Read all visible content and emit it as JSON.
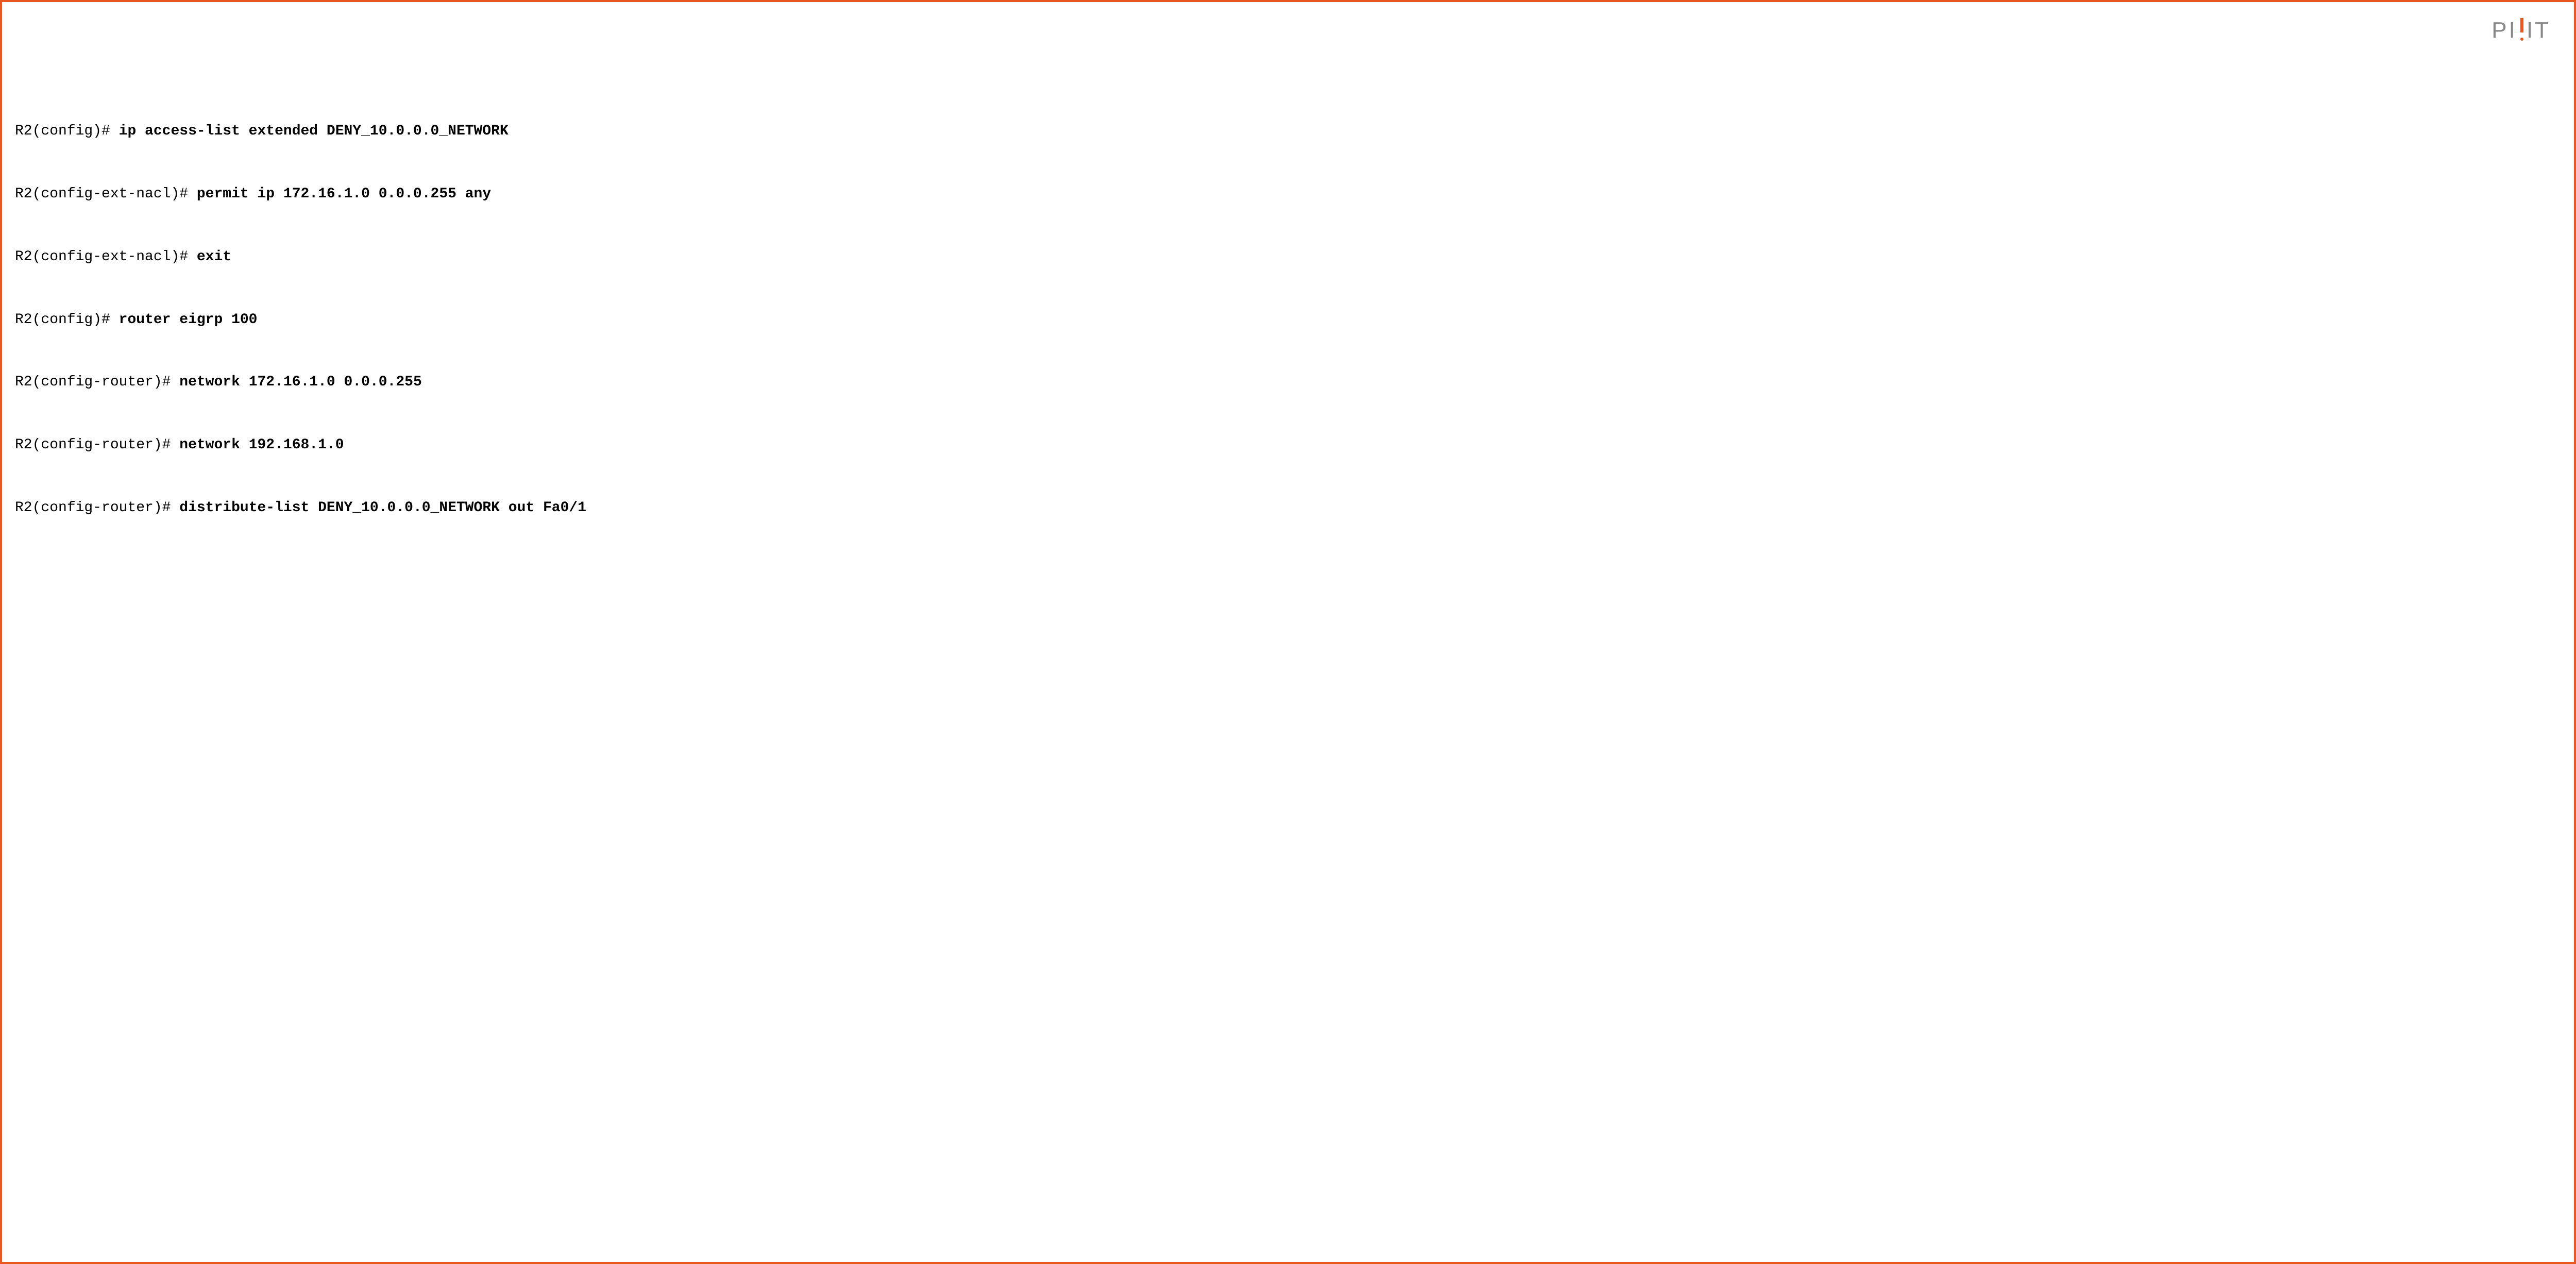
{
  "logo": {
    "p1": "P",
    "i1": "I",
    "i2": "I",
    "t": "T"
  },
  "terminal": {
    "lines": [
      {
        "prompt": "R2(config)# ",
        "command": "ip access-list extended DENY_10.0.0.0_NETWORK"
      },
      {
        "prompt": "R2(config-ext-nacl)# ",
        "command": "permit ip 172.16.1.0 0.0.0.255 any"
      },
      {
        "prompt": "R2(config-ext-nacl)# ",
        "command": "exit"
      },
      {
        "prompt": "R2(config)# ",
        "command": "router eigrp 100"
      },
      {
        "prompt": "R2(config-router)# ",
        "command": "network 172.16.1.0 0.0.0.255"
      },
      {
        "prompt": "R2(config-router)# ",
        "command": "network 192.168.1.0"
      },
      {
        "prompt": "R2(config-router)# ",
        "command": "distribute-list DENY_10.0.0.0_NETWORK out Fa0/1"
      }
    ]
  }
}
